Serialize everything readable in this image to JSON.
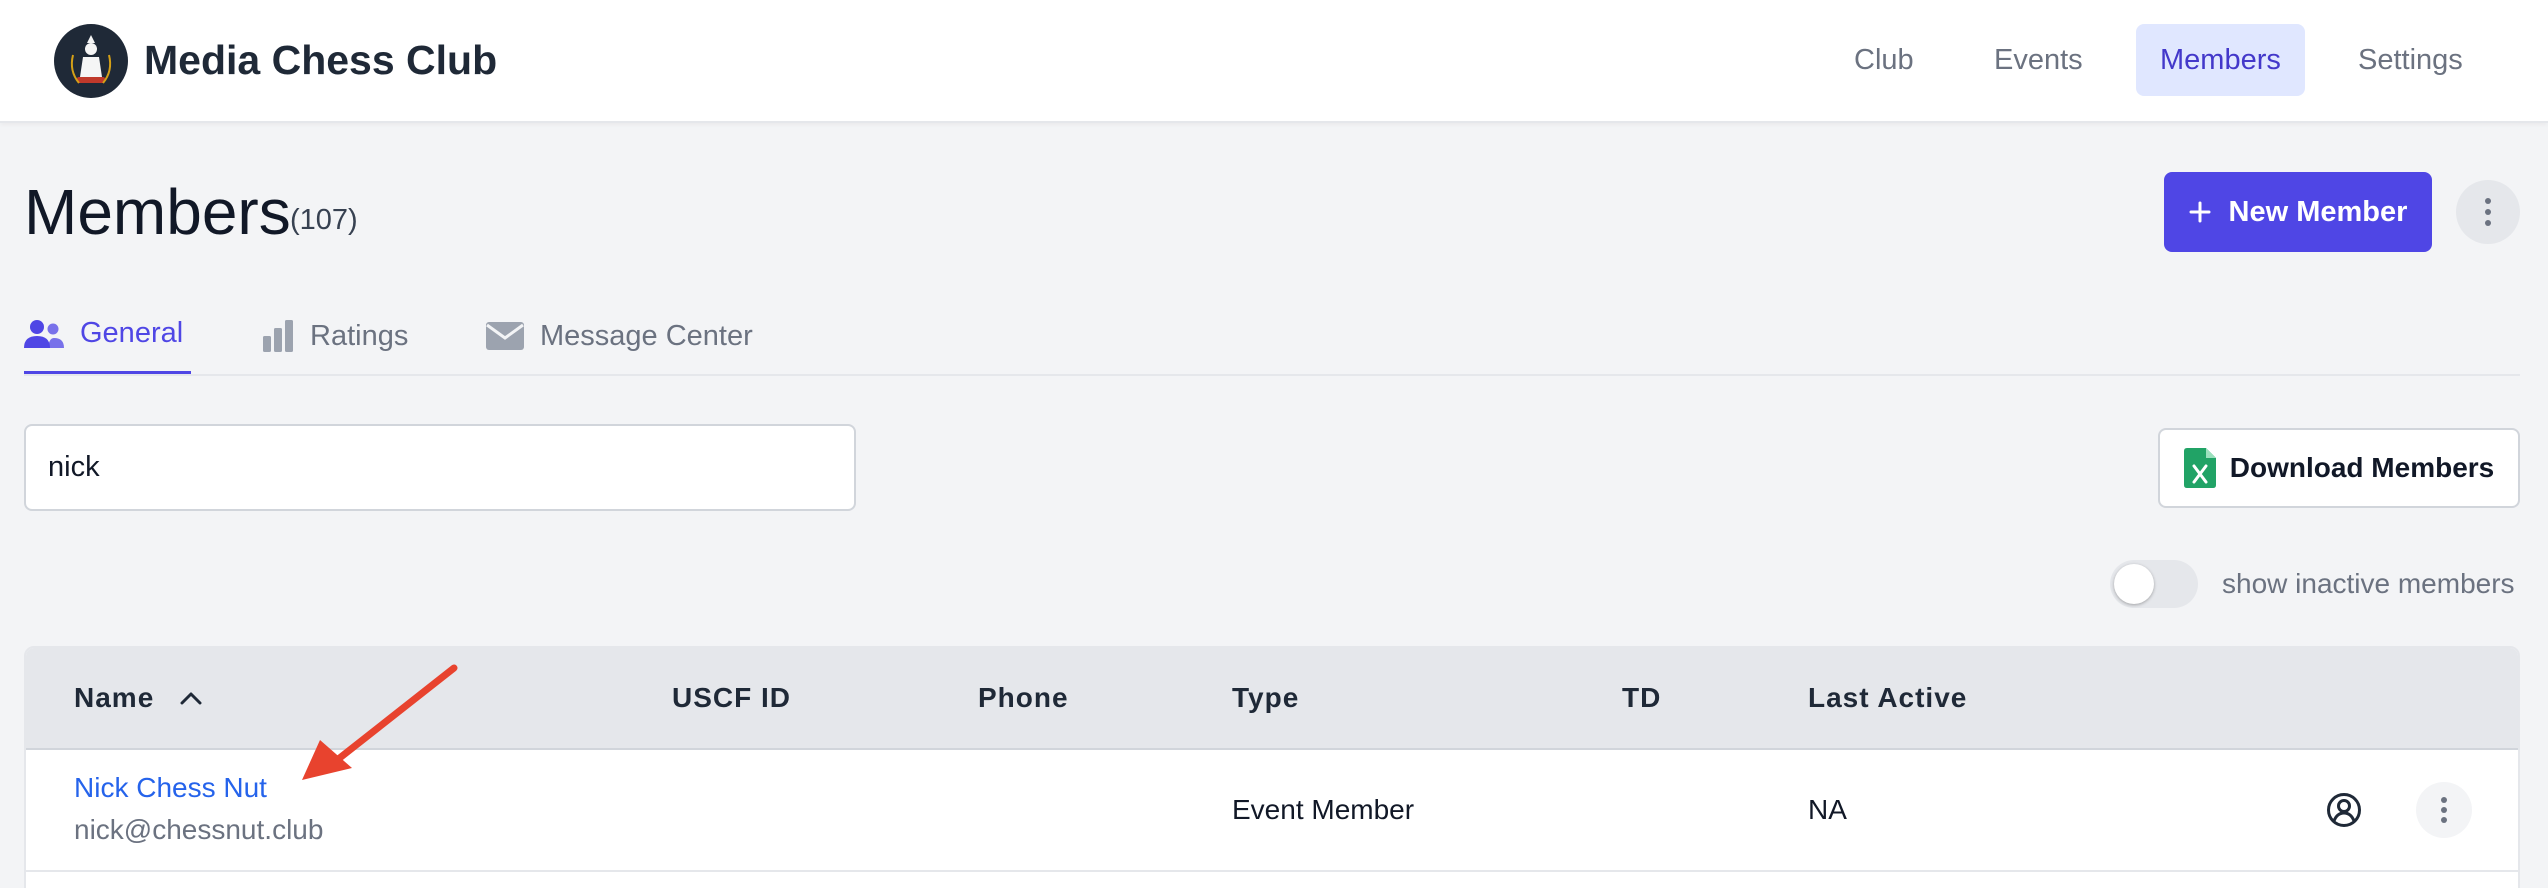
{
  "header": {
    "brand": "Media Chess Club",
    "nav": [
      {
        "label": "Club",
        "active": false
      },
      {
        "label": "Events",
        "active": false
      },
      {
        "label": "Members",
        "active": true
      },
      {
        "label": "Settings",
        "active": false
      }
    ]
  },
  "page": {
    "title": "Members",
    "count": "(107)",
    "new_button": "New Member"
  },
  "tabs": [
    {
      "label": "General",
      "icon": "users-icon",
      "active": true
    },
    {
      "label": "Ratings",
      "icon": "bar-chart-icon",
      "active": false
    },
    {
      "label": "Message Center",
      "icon": "envelope-icon",
      "active": false
    }
  ],
  "search": {
    "value": "nick"
  },
  "download_button": "Download Members",
  "toggle": {
    "label": "show inactive members",
    "on": false
  },
  "table": {
    "columns": [
      "Name",
      "USCF ID",
      "Phone",
      "Type",
      "TD",
      "Last Active"
    ],
    "rows": [
      {
        "name": "Nick Chess Nut",
        "email": "nick@chessnut.club",
        "uscf_id": "",
        "phone": "",
        "type": "Event Member",
        "td": "",
        "last_active": "NA"
      }
    ]
  },
  "colors": {
    "accent": "#4f46e5",
    "link": "#2563eb",
    "annotation_arrow": "#e8432e",
    "excel_green": "#21a366"
  }
}
